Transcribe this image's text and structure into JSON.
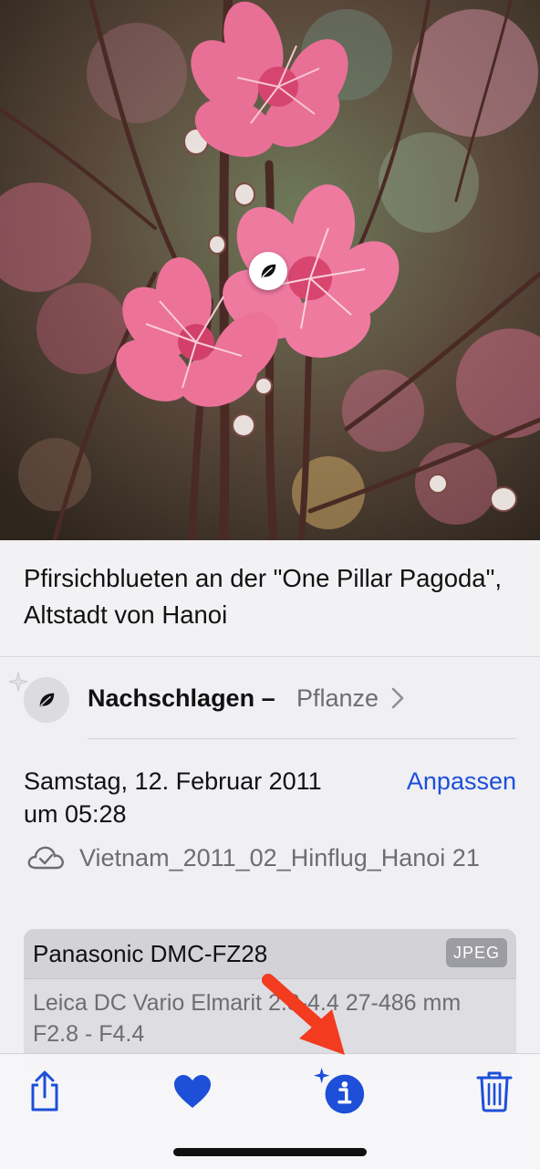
{
  "caption": {
    "text": "Pfirsichblueten an der \"One Pillar Pagoda\", Altstadt von Hanoi"
  },
  "lookup": {
    "label": "Nachschlagen –",
    "type": "Pflanze",
    "icon": "leaf-icon"
  },
  "date": {
    "line1": "Samstag, 12. Februar 2011",
    "line2": "um 05:28",
    "adjust_label": "Anpassen"
  },
  "album": {
    "icon": "cloud-check-icon",
    "name": "Vietnam_2011_02_Hinflug_Hanoi 21"
  },
  "exif": {
    "camera": "Panasonic DMC-FZ28",
    "format": "JPEG",
    "lens": "Leica DC Vario Elmarit 2.8-4.4 27-486 mm F2.8 - F4.4"
  },
  "toolbar": {
    "items": [
      "share-icon",
      "heart-icon",
      "info-sparkle-icon",
      "trash-icon"
    ]
  },
  "colors": {
    "accent": "#1d4fd8",
    "annotation_arrow": "#f23b1f"
  }
}
